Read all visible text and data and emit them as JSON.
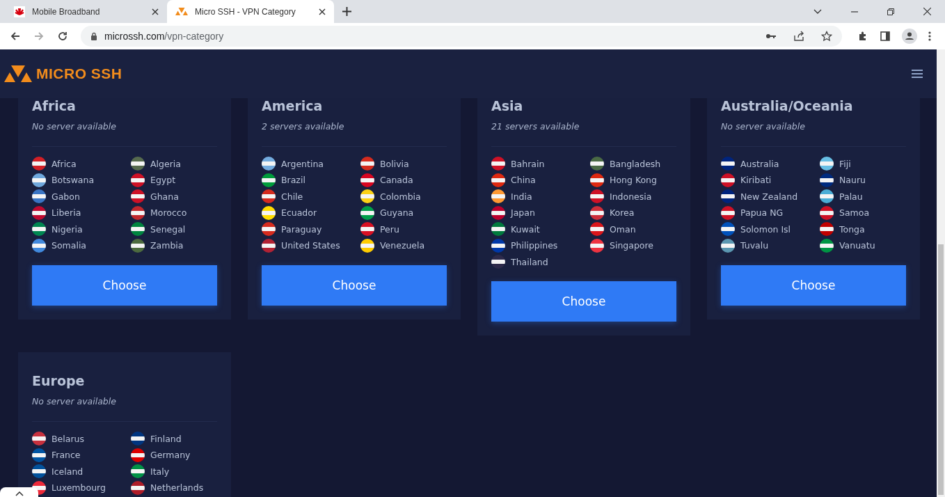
{
  "browser": {
    "tabs": [
      {
        "title": "Mobile Broadband",
        "selected": false
      },
      {
        "title": "Micro SSH - VPN Category",
        "selected": true
      }
    ],
    "address": {
      "domain": "microssh.com",
      "path": "/vpn-category"
    }
  },
  "site": {
    "logo": "MICRO SSH"
  },
  "regions": [
    {
      "name": "Africa",
      "availability": "No server available",
      "button": "Choose",
      "countries": [
        {
          "name": "Africa",
          "color": "#d21f26"
        },
        {
          "name": "Algeria",
          "color": "#566a4e"
        },
        {
          "name": "Botswana",
          "color": "#6fa8dc"
        },
        {
          "name": "Egypt",
          "color": "#ce1126"
        },
        {
          "name": "Gabon",
          "color": "#3a75c4"
        },
        {
          "name": "Ghana",
          "color": "#ce1126"
        },
        {
          "name": "Liberia",
          "color": "#bf0a30"
        },
        {
          "name": "Morocco",
          "color": "#c1272d"
        },
        {
          "name": "Nigeria",
          "color": "#008751"
        },
        {
          "name": "Senegal",
          "color": "#00853f"
        },
        {
          "name": "Somalia",
          "color": "#4189dd"
        },
        {
          "name": "Zambia",
          "color": "#4d6b3f"
        }
      ]
    },
    {
      "name": "America",
      "availability": "2 servers available",
      "button": "Choose",
      "countries": [
        {
          "name": "Argentina",
          "color": "#74acdf"
        },
        {
          "name": "Bolivia",
          "color": "#d52b1e"
        },
        {
          "name": "Brazil",
          "color": "#009c3b"
        },
        {
          "name": "Canada",
          "color": "#d80621"
        },
        {
          "name": "Chile",
          "color": "#d52b1e"
        },
        {
          "name": "Colombia",
          "color": "#fcd116"
        },
        {
          "name": "Ecuador",
          "color": "#ffdd00"
        },
        {
          "name": "Guyana",
          "color": "#009e49"
        },
        {
          "name": "Paraguay",
          "color": "#d52b1e"
        },
        {
          "name": "Peru",
          "color": "#d91023"
        },
        {
          "name": "United States",
          "color": "#b22234"
        },
        {
          "name": "Venezuela",
          "color": "#ffcc00"
        }
      ]
    },
    {
      "name": "Asia",
      "availability": "21 servers available",
      "button": "Choose",
      "countries": [
        {
          "name": "Bahrain",
          "color": "#ce1126"
        },
        {
          "name": "Bangladesh",
          "color": "#4a6a44"
        },
        {
          "name": "China",
          "color": "#de2910"
        },
        {
          "name": "Hong Kong",
          "color": "#de2910"
        },
        {
          "name": "India",
          "color": "#ff9933"
        },
        {
          "name": "Indonesia",
          "color": "#ce1126"
        },
        {
          "name": "Japan",
          "color": "#bc002d"
        },
        {
          "name": "Korea",
          "color": "#cd2e3a"
        },
        {
          "name": "Kuwait",
          "color": "#007a3d"
        },
        {
          "name": "Oman",
          "color": "#db161b"
        },
        {
          "name": "Philippines",
          "color": "#0038a8"
        },
        {
          "name": "Singapore",
          "color": "#ef3340"
        },
        {
          "name": "Thailand",
          "color": "#2d2a4a"
        }
      ]
    },
    {
      "name": "Australia/Oceania",
      "availability": "No server available",
      "button": "Choose",
      "countries": [
        {
          "name": "Australia",
          "color": "#00247d"
        },
        {
          "name": "Fiji",
          "color": "#68bfe5"
        },
        {
          "name": "Kiribati",
          "color": "#ce1126"
        },
        {
          "name": "Nauru",
          "color": "#002b7f"
        },
        {
          "name": "New Zealand",
          "color": "#00247d"
        },
        {
          "name": "Palau",
          "color": "#4aadd6"
        },
        {
          "name": "Papua NG",
          "color": "#ce1126"
        },
        {
          "name": "Samoa",
          "color": "#ce1126"
        },
        {
          "name": "Solomon Isl",
          "color": "#0051ba"
        },
        {
          "name": "Tonga",
          "color": "#c10000"
        },
        {
          "name": "Tuvalu",
          "color": "#5b97b1"
        },
        {
          "name": "Vanuatu",
          "color": "#009543"
        }
      ]
    },
    {
      "name": "Europe",
      "availability": "No server available",
      "countries": [
        {
          "name": "Belarus",
          "color": "#c8313e"
        },
        {
          "name": "Finland",
          "color": "#003580"
        },
        {
          "name": "France",
          "color": "#0055a4"
        },
        {
          "name": "Germany",
          "color": "#dd0000"
        },
        {
          "name": "Iceland",
          "color": "#02529c"
        },
        {
          "name": "Italy",
          "color": "#009246"
        },
        {
          "name": "Luxembourg",
          "color": "#ed2939"
        },
        {
          "name": "Netherlands",
          "color": "#ae1c28"
        }
      ]
    }
  ]
}
